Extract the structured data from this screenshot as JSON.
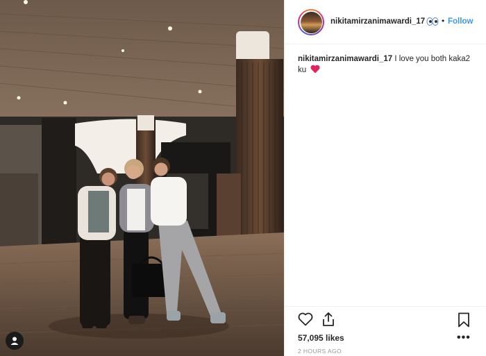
{
  "post": {
    "photo_alt": "",
    "header": {
      "username": "nikitamirzanimawardi_17",
      "follow_label": "Follow",
      "separator": "•"
    },
    "caption": {
      "username": "nikitamirzanimawardi_17",
      "text": "I love you both kaka2 ku"
    },
    "actions": {
      "likes": "57,095 likes",
      "time": "2 HOURS AGO",
      "more": "•••"
    },
    "icons": {
      "user_tag": "user-tag-icon",
      "like": "heart-outline-icon",
      "share": "share-icon",
      "save": "bookmark-icon",
      "heart_emoji": "red-heart-emoji",
      "eyes_emoji": "emoji-icon"
    },
    "colors": {
      "follow": "#3897f0",
      "heart": "#e0245e"
    }
  }
}
